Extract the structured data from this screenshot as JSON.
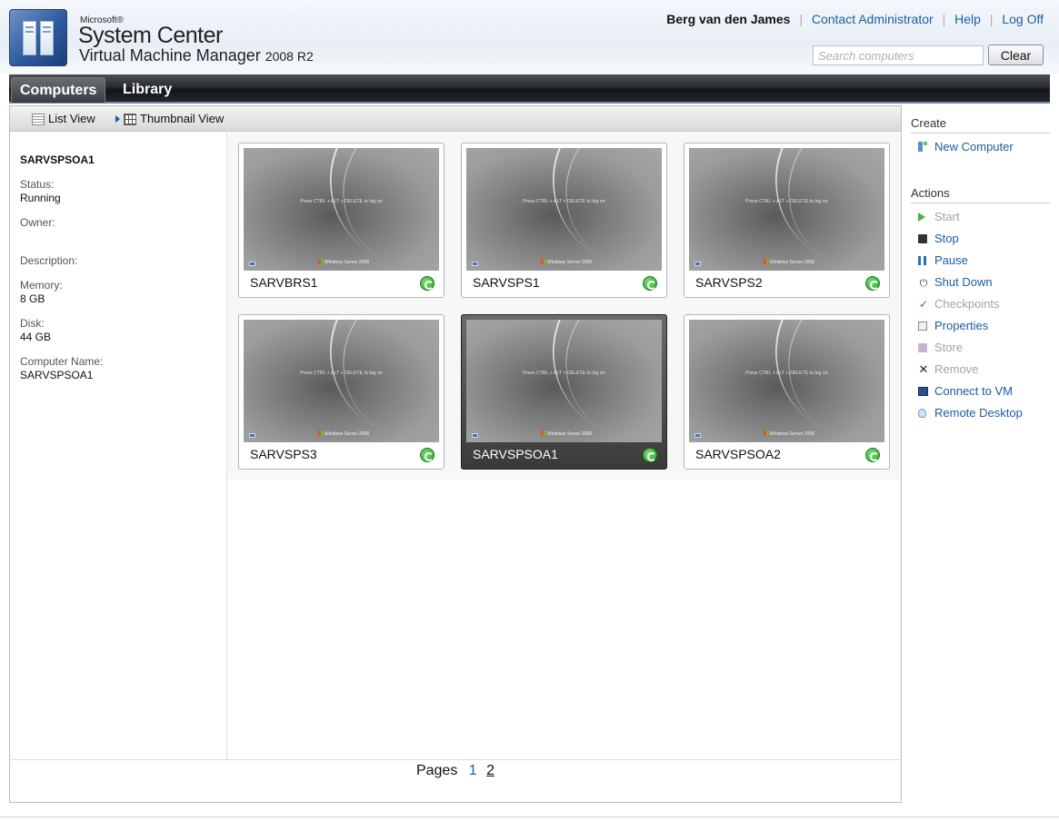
{
  "app": {
    "brand_small": "Microsoft®",
    "brand_title": "System Center",
    "brand_subtitle": "Virtual Machine Manager",
    "brand_version": "2008 R2"
  },
  "header": {
    "user_name": "Berg van den James",
    "links": [
      "Contact Administrator",
      "Help",
      "Log Off"
    ],
    "search_placeholder": "Search computers",
    "search_value": "",
    "clear_label": "Clear"
  },
  "nav": {
    "tabs": [
      {
        "label": "Computers",
        "active": true
      },
      {
        "label": "Library",
        "active": false
      }
    ]
  },
  "toolbar": {
    "list_view_label": "List View",
    "thumbnail_view_label": "Thumbnail View",
    "active_view": "Thumbnail View"
  },
  "details": {
    "title": "SARVSPSOA1",
    "fields": [
      {
        "label": "Status:",
        "value": "Running"
      },
      {
        "label": "Owner:",
        "value": ""
      },
      {
        "label": "Description:",
        "value": ""
      },
      {
        "label": "Memory:",
        "value": "8 GB"
      },
      {
        "label": "Disk:",
        "value": "44 GB"
      },
      {
        "label": "Computer Name:",
        "value": "SARVSPSOA1"
      }
    ]
  },
  "vms": [
    {
      "name": "SARVBRS1",
      "status": "running",
      "selected": false
    },
    {
      "name": "SARVSPS1",
      "status": "running",
      "selected": false
    },
    {
      "name": "SARVSPS2",
      "status": "running",
      "selected": false
    },
    {
      "name": "SARVSPS3",
      "status": "running",
      "selected": false
    },
    {
      "name": "SARVSPSOA1",
      "status": "running",
      "selected": true
    },
    {
      "name": "SARVSPSOA2",
      "status": "running",
      "selected": false
    }
  ],
  "vm_screen": {
    "login_prompt": "Press CTRL + ALT + DELETE to log on",
    "os_logo_text": "Windows Server 2008"
  },
  "pager": {
    "label": "Pages",
    "pages": [
      "1",
      "2"
    ],
    "current": "1"
  },
  "right_pane": {
    "create_heading": "Create",
    "create_items": [
      {
        "label": "New Computer",
        "icon": "new-computer-icon",
        "enabled": true
      }
    ],
    "actions_heading": "Actions",
    "action_items": [
      {
        "label": "Start",
        "icon": "start-icon",
        "enabled": false
      },
      {
        "label": "Stop",
        "icon": "stop-icon",
        "enabled": true
      },
      {
        "label": "Pause",
        "icon": "pause-icon",
        "enabled": true
      },
      {
        "label": "Shut Down",
        "icon": "shutdown-icon",
        "enabled": true
      },
      {
        "label": "Checkpoints",
        "icon": "checkpoints-icon",
        "enabled": false
      },
      {
        "label": "Properties",
        "icon": "properties-icon",
        "enabled": true
      },
      {
        "label": "Store",
        "icon": "store-icon",
        "enabled": false
      },
      {
        "label": "Remove",
        "icon": "remove-icon",
        "enabled": false
      },
      {
        "label": "Connect to VM",
        "icon": "connect-icon",
        "enabled": true
      },
      {
        "label": "Remote Desktop",
        "icon": "remote-desktop-icon",
        "enabled": true
      }
    ]
  },
  "colors": {
    "link": "#1a5da6",
    "nav_bg": "#23272c",
    "running_green": "#27a124",
    "disabled": "#a3a3a3"
  }
}
